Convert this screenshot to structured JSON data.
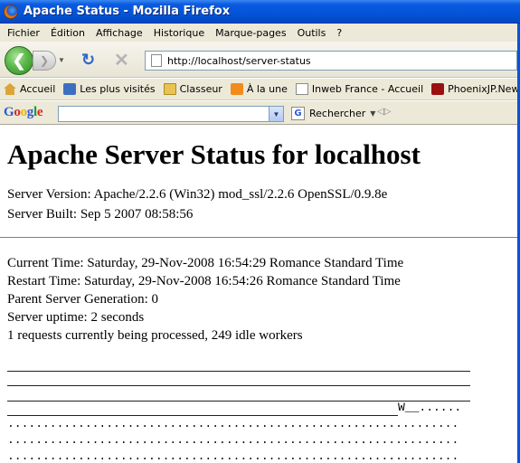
{
  "window": {
    "title": "Apache Status - Mozilla Firefox"
  },
  "menu": [
    "Fichier",
    "Édition",
    "Affichage",
    "Historique",
    "Marque-pages",
    "Outils",
    "?"
  ],
  "navigation": {
    "url": "http://localhost/server-status"
  },
  "bookmarks": [
    {
      "label": "Accueil",
      "icon": "home-icon"
    },
    {
      "label": "Les plus visités",
      "icon": "most-visited-icon"
    },
    {
      "label": "Classeur",
      "icon": "folder-icon"
    },
    {
      "label": "À la une",
      "icon": "rss-icon"
    },
    {
      "label": "Inweb France - Accueil",
      "icon": "page-icon"
    },
    {
      "label": "PhoenixJP.News le po...",
      "icon": "phoenixjp-icon"
    }
  ],
  "googlebar": {
    "logo": "Google",
    "search_label": "Rechercher"
  },
  "content": {
    "heading": "Apache Server Status for localhost",
    "server_version": "Server Version: Apache/2.2.6 (Win32) mod_ssl/2.2.6 OpenSSL/0.9.8e",
    "server_built": "Server Built: Sep 5 2007 08:58:56",
    "current_time": "Current Time: Saturday, 29-Nov-2008 16:54:29 Romance Standard Time",
    "restart_time": "Restart Time: Saturday, 29-Nov-2008 16:54:26 Romance Standard Time",
    "parent_generation": "Parent Server Generation: 0",
    "uptime": "Server uptime: 2 seconds",
    "requests": "1 requests currently being processed, 249 idle workers",
    "scoreboard_mid": "W__......",
    "scoreboard_dots": "................................................................"
  }
}
